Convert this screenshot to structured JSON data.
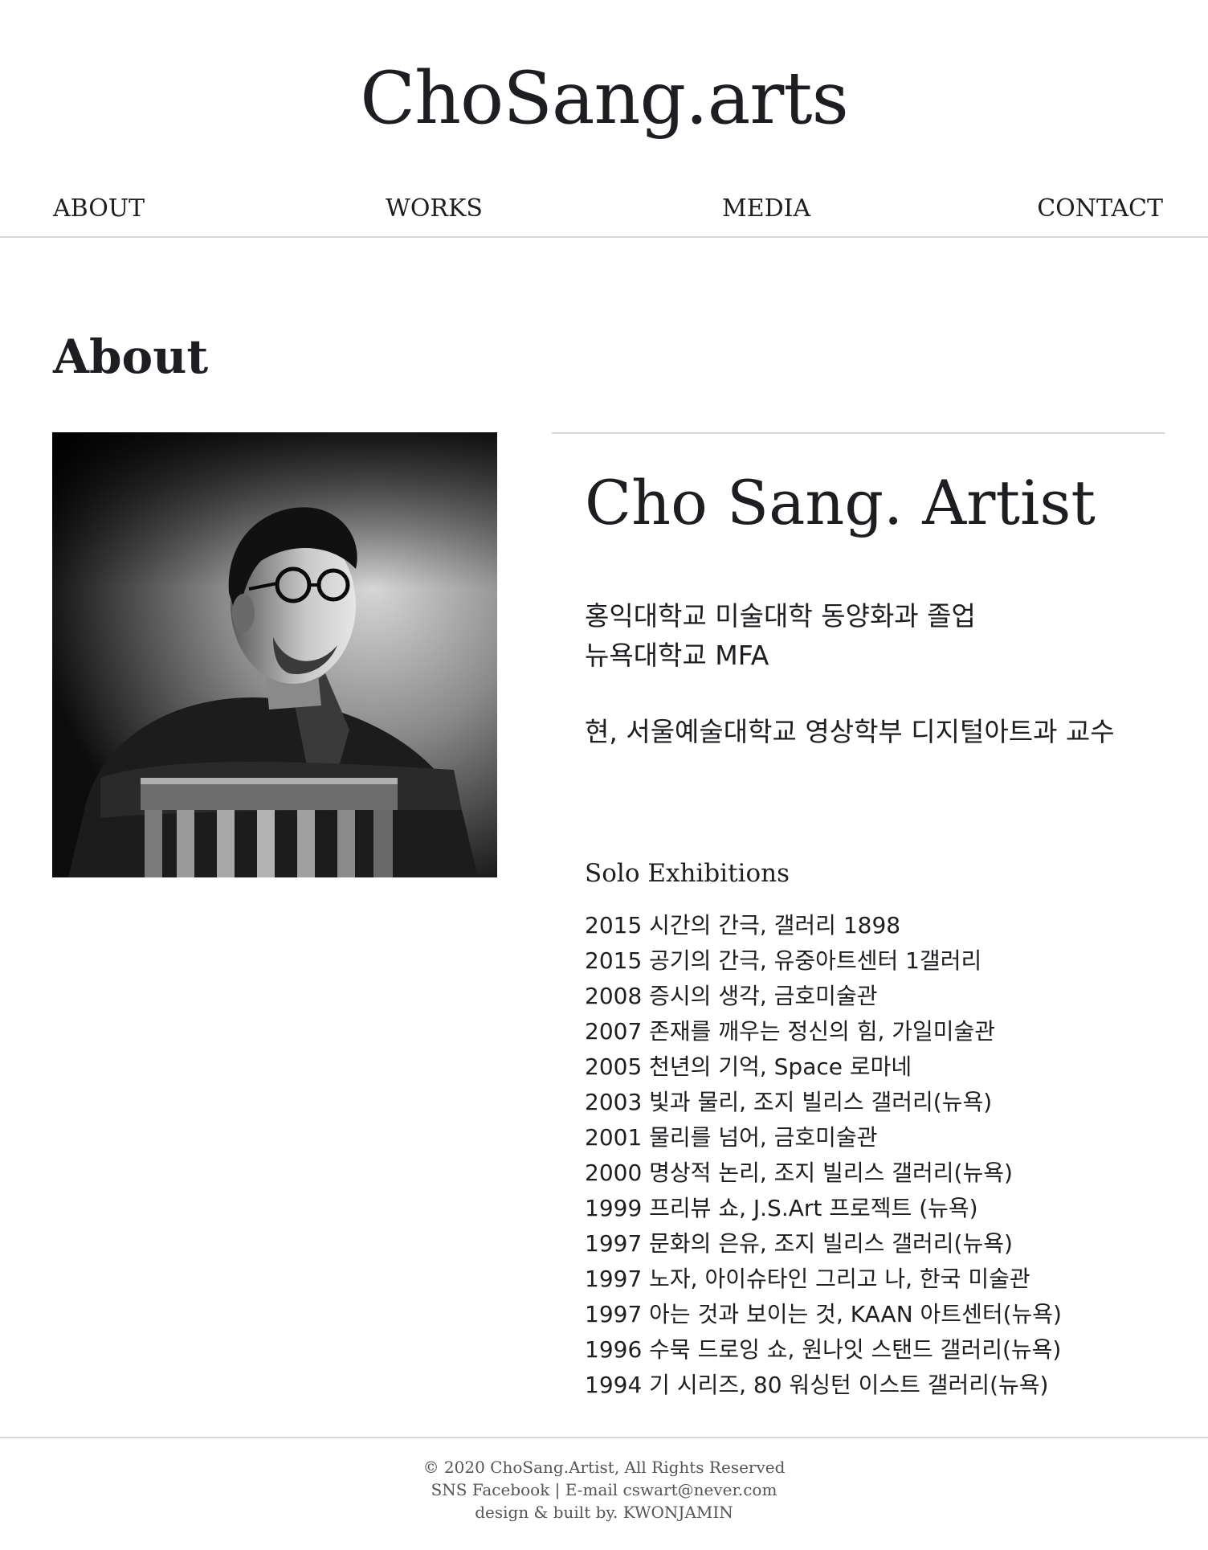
{
  "site": {
    "title": "ChoSang.arts"
  },
  "nav": {
    "items": [
      {
        "label": "ABOUT"
      },
      {
        "label": "WORKS"
      },
      {
        "label": "MEDIA"
      },
      {
        "label": "CONTACT"
      }
    ]
  },
  "page": {
    "title": "About"
  },
  "portrait": {
    "alt": "Black and white portrait of the artist wearing round glasses, leaning on a wooden chair back"
  },
  "bio": {
    "name": "Cho Sang. Artist",
    "education": [
      "홍익대학교 미술대학 동양화과 졸업",
      "뉴욕대학교 MFA"
    ],
    "current": "현, 서울예술대학교 영상학부 디지털아트과 교수"
  },
  "solo": {
    "heading": "Solo Exhibitions",
    "items": [
      "2015 시간의 간극, 갤러리 1898",
      "2015 공기의 간극, 유중아트센터 1갤러리",
      "2008 증시의 생각, 금호미술관",
      "2007 존재를 깨우는 정신의 힘, 가일미술관",
      "2005 천년의 기억, Space 로마네",
      "2003 빛과 물리, 조지 빌리스 갤러리(뉴욕)",
      "2001 물리를 넘어, 금호미술관",
      "2000 명상적 논리, 조지 빌리스 갤러리(뉴욕)",
      "1999 프리뷰 쇼, J.S.Art 프로젝트 (뉴욕)",
      "1997 문화의 은유, 조지 빌리스 갤러리(뉴욕)",
      "1997 노자, 아이슈타인 그리고 나, 한국 미술관",
      "1997 아는 것과 보이는 것, KAAN 아트센터(뉴욕)",
      "1996 수묵 드로잉 쇼, 원나잇 스탠드 갤러리(뉴욕)",
      "1994 기 시리즈, 80 워싱턴 이스트 갤러리(뉴욕)"
    ]
  },
  "footer": {
    "copyright": "© 2020 ChoSang.Artist, All Rights Reserved",
    "sns_label": "SNS Facebook",
    "separator": " | ",
    "email_label": "E-mail cswart@never.com",
    "credit": "design & built by. KWONJAMIN"
  }
}
